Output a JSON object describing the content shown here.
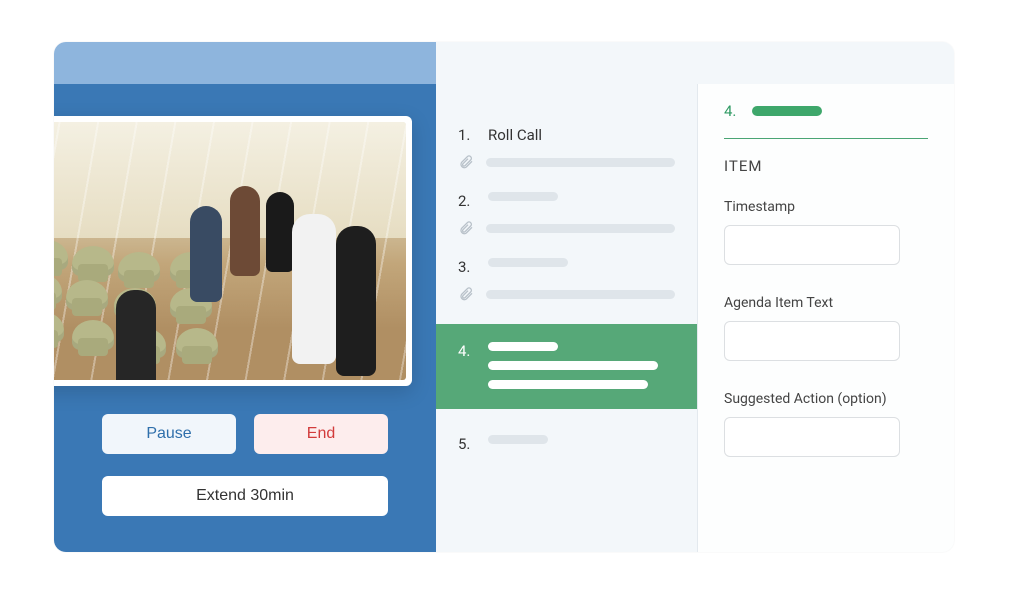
{
  "controls": {
    "pause_label": "Pause",
    "end_label": "End",
    "extend_label": "Extend 30min"
  },
  "agenda": {
    "items": [
      {
        "num": "1.",
        "title": "Roll Call"
      },
      {
        "num": "2."
      },
      {
        "num": "3."
      },
      {
        "num": "4."
      },
      {
        "num": "5."
      }
    ],
    "active_index": 3
  },
  "detail": {
    "active_num": "4.",
    "heading": "ITEM",
    "fields": {
      "timestamp_label": "Timestamp",
      "timestamp_value": "",
      "agenda_text_label": "Agenda Item Text",
      "agenda_text_value": "",
      "suggested_action_label": "Suggested Action (option)",
      "suggested_action_value": ""
    }
  },
  "colors": {
    "primary_blue": "#3a78b5",
    "accent_green": "#56a878",
    "danger_red": "#d23b3b"
  }
}
